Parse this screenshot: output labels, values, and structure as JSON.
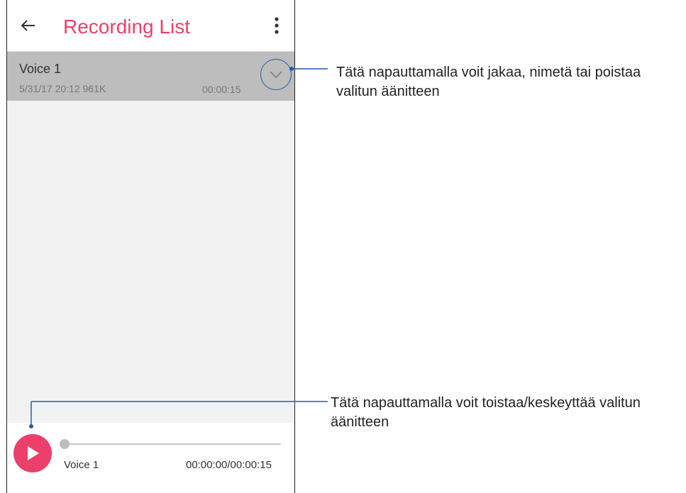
{
  "app": {
    "title": "Recording List",
    "accent_color": "#ec3f6b",
    "back_icon": "arrow-left-icon",
    "more_icon": "more-vertical-icon"
  },
  "recordings": [
    {
      "name": "Voice 1",
      "meta": "5/31/17 20:12  961K",
      "duration": "00:00:15",
      "expand_icon": "chevron-down-icon"
    }
  ],
  "player": {
    "play_icon": "play-icon",
    "name": "Voice 1",
    "time": "00:00:00/00:00:15",
    "progress": 0
  },
  "callouts": [
    {
      "text": "Tätä napauttamalla voit jakaa, nimetä tai poistaa valitun äänitteen"
    },
    {
      "text": "Tätä napauttamalla voit toistaa/keskeyttää valitun äänitteen"
    }
  ],
  "callout_line_color": "#1f5fa8"
}
